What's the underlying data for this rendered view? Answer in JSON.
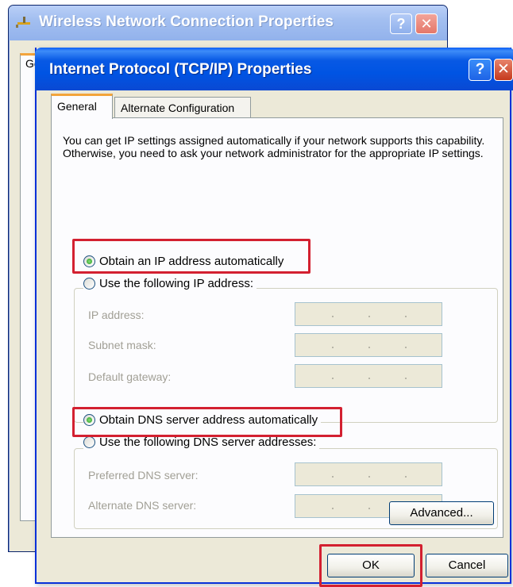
{
  "background_window": {
    "title": "Wireless Network Connection Properties",
    "help_label": "?",
    "close_label": "✕",
    "tab_fragment": "General"
  },
  "dialog": {
    "title": "Internet Protocol (TCP/IP) Properties",
    "help_label": "?",
    "close_label": "✕",
    "tabs": [
      {
        "label": "General",
        "active": true
      },
      {
        "label": "Alternate Configuration",
        "active": false
      }
    ],
    "intro_text": "You can get IP settings assigned automatically if your network supports this capability. Otherwise, you need to ask your network administrator for the appropriate IP settings.",
    "ip": {
      "auto_label": "Obtain an IP address automatically",
      "manual_label": "Use the following IP address:",
      "selected": "auto",
      "fields": [
        {
          "label": "IP address:",
          "value": ""
        },
        {
          "label": "Subnet mask:",
          "value": ""
        },
        {
          "label": "Default gateway:",
          "value": ""
        }
      ]
    },
    "dns": {
      "auto_label": "Obtain DNS server address automatically",
      "manual_label": "Use the following DNS server addresses:",
      "selected": "auto",
      "fields": [
        {
          "label": "Preferred DNS server:",
          "value": ""
        },
        {
          "label": "Alternate DNS server:",
          "value": ""
        }
      ]
    },
    "buttons": {
      "advanced": "Advanced...",
      "ok": "OK",
      "cancel": "Cancel"
    }
  },
  "colors": {
    "highlight": "#d32030",
    "titlebar": "#0054e3",
    "dialog_bg": "#ece9d8"
  }
}
